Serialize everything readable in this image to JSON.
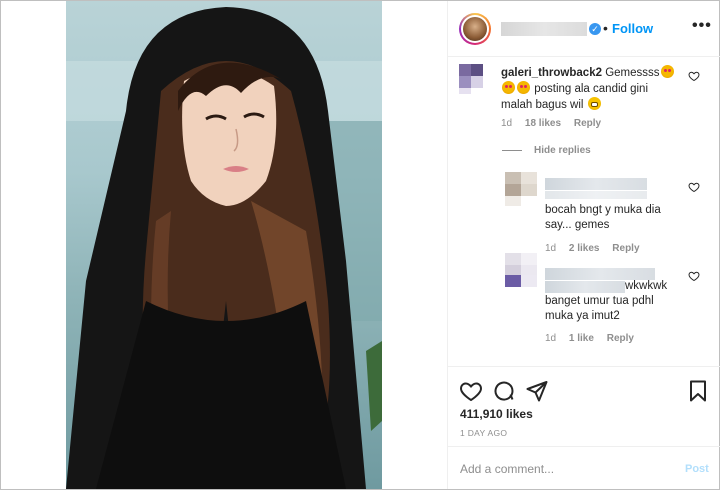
{
  "header": {
    "follow_label": "Follow",
    "dot": "•",
    "more": "•••",
    "verified_check": "✓"
  },
  "comments": {
    "main": {
      "username": "galeri_throwback2",
      "text_part1": "Gemessss",
      "text_part2": "posting ala candid gini",
      "text_part3": "malah bagus wil",
      "time": "1d",
      "likes": "18 likes",
      "reply": "Reply"
    },
    "hide_replies": "Hide replies",
    "replies": [
      {
        "line1": "bocah bngt y muka dia",
        "line2": "say... gemes",
        "time": "1d",
        "likes": "2 likes",
        "reply": "Reply"
      },
      {
        "line0_suffix": "wkwkwk",
        "line1": "banget umur tua pdhl",
        "line2": "muka ya imut2",
        "time": "1d",
        "likes": "1 like",
        "reply": "Reply"
      }
    ]
  },
  "actions": {
    "likes_count": "411,910 likes",
    "time_ago": "1 DAY AGO",
    "icons": [
      "heart-icon",
      "comment-icon",
      "share-icon",
      "bookmark-icon"
    ]
  },
  "add_comment": {
    "placeholder": "Add a comment...",
    "post_label": "Post"
  },
  "colors": {
    "accent": "#0095f6",
    "post_disabled": "#b2dffc",
    "muted": "#8e8e8e",
    "verified": "#3897f0"
  }
}
